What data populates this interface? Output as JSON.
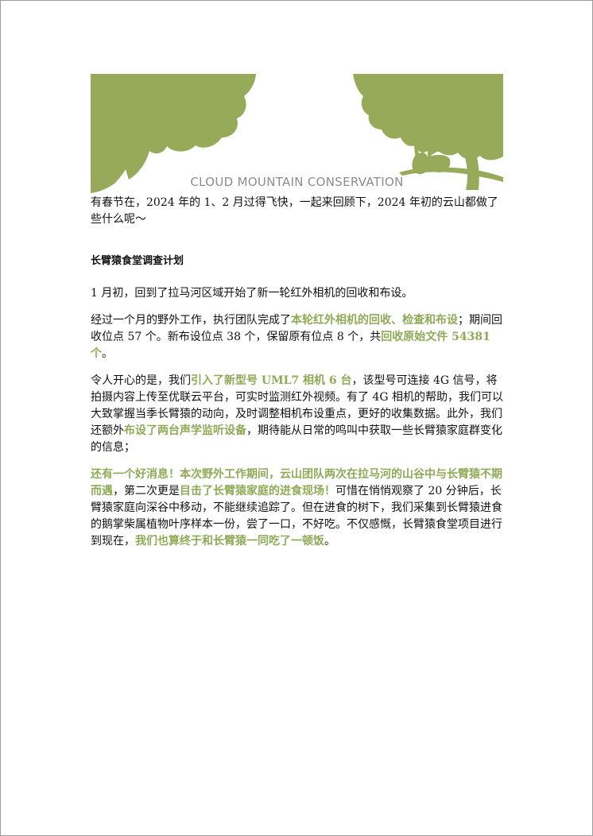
{
  "banner": {
    "text": "CLOUD MOUNTAIN CONSERVATION",
    "colors": {
      "foliage": "#97aa5a",
      "text": "#8c8c8c"
    }
  },
  "intro": "有春节在，2024 年的 1、2 月过得飞快，一起来回顾下，2024 年初的云山都做了些什么呢～",
  "section_title": "长臂猿食堂调查计划",
  "p1": "1 月初，回到了拉马河区域开始了新一轮红外相机的回收和布设。",
  "p2": {
    "t1": "经过一个月的野外工作，执行团队完成了",
    "h1": "本轮红外相机的回收、检查和布设",
    "t2": "；期间回收位点 57 个。新布设位点 38 个，保留原有位点 8 个，共",
    "h2": "回收原始文件 54381 个",
    "t3": "。"
  },
  "p3": {
    "t1": "令人开心的是，我们",
    "h1": "引入了新型号 UML7 相机 6 台",
    "t2": "，该型号可连接 4G 信号，将拍摄内容上传至优联云平台，可实时监测红外视频。有了 4G 相机的帮助，我们可以大致掌握当季长臂猿的动向，及时调整相机布设重点，更好的收集数据。此外，我们还额外",
    "h2": "布设了两台声学监听设备",
    "t3": "，期待能从日常的鸣叫中获取一些长臂猿家庭群变化的信息；"
  },
  "p4": {
    "h1": "还有一个好消息！本次野外工作期间，云山团队两次在拉马河的山谷中与长臂猿不期而遇",
    "t1": "，第二次更是",
    "h2": "目击了长臂猿家庭的进食现场！",
    "t2": "可惜在悄悄观察了 20 分钟后，长臂猿家庭向深谷中移动，不能继续追踪了。但在进食的树下，我们采集到长臂猿进食的鹅掌柴属植物叶序样本一份，尝了一口，不好吃。不仅感慨，长臂猿食堂项目进行到现在，",
    "h3": "我们也算终于和长臂猿一同吃了一顿饭",
    "t3": "。"
  }
}
